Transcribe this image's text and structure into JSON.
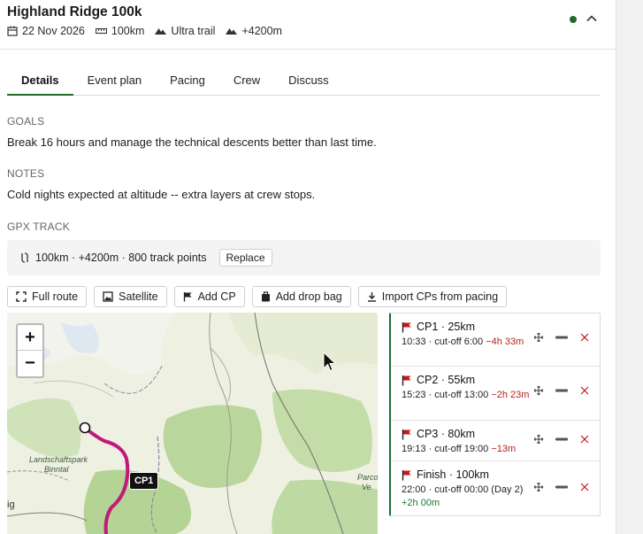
{
  "header": {
    "title": "Highland Ridge 100k",
    "date": "22 Nov 2026",
    "distance": "100km",
    "type": "Ultra trail",
    "elevation": "+4200m",
    "status_color": "#1e6b2a"
  },
  "tabs": [
    {
      "label": "Details",
      "active": true
    },
    {
      "label": "Event plan",
      "active": false
    },
    {
      "label": "Pacing",
      "active": false
    },
    {
      "label": "Crew",
      "active": false
    },
    {
      "label": "Discuss",
      "active": false
    }
  ],
  "goals": {
    "label": "GOALS",
    "text": "Break 16 hours and manage the technical descents better than last time."
  },
  "notes": {
    "label": "NOTES",
    "text": "Cold nights expected at altitude -- extra layers at crew stops."
  },
  "gpx": {
    "label": "GPX TRACK",
    "summary": "100km · +4200m · 800 track points",
    "replace_label": "Replace"
  },
  "toolbar": {
    "full_route": "Full route",
    "satellite": "Satellite",
    "add_cp": "Add CP",
    "add_drop_bag": "Add drop bag",
    "import_cps": "Import CPs from pacing"
  },
  "map": {
    "zoom_in": "+",
    "zoom_out": "−",
    "marker_label": "CP1",
    "place_1": "Landschaftspark",
    "place_2": "Binntal",
    "place_3": "Parco",
    "place_4": "Ve",
    "place_5": "ig",
    "route_color": "#c2187a"
  },
  "checkpoints": [
    {
      "title": "CP1 · 25km",
      "times": "10:33 · cut-off 6:00 ",
      "delta": "−4h 33m",
      "delta_kind": "bad"
    },
    {
      "title": "CP2 · 55km",
      "times": "15:23 · cut-off 13:00 ",
      "delta": "−2h 23m",
      "delta_kind": "bad"
    },
    {
      "title": "CP3 · 80km",
      "times": "19:13 · cut-off 19:00 ",
      "delta": "−13m",
      "delta_kind": "bad"
    },
    {
      "title": "Finish · 100km",
      "times": "22:00 · cut-off 00:00 (Day 2) ",
      "delta": "+2h 00m",
      "delta_kind": "good"
    }
  ]
}
